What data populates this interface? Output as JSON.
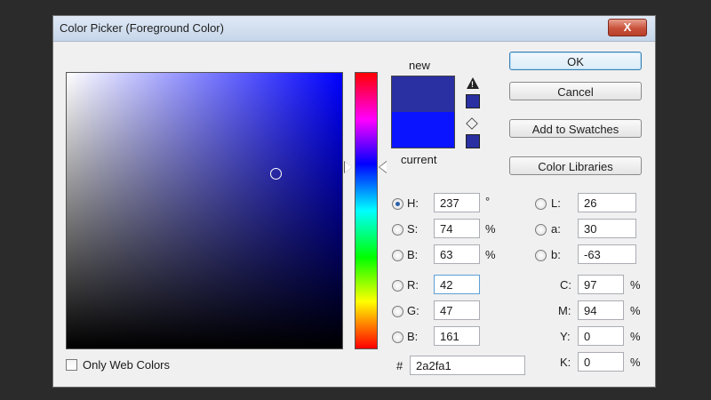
{
  "dialog": {
    "title": "Color Picker (Foreground Color)",
    "close_label": "X"
  },
  "colors": {
    "new_color": "#2a2fa1",
    "current_color": "#0a14ff",
    "field_hue": "#0000ff"
  },
  "preview": {
    "new_label": "new",
    "current_label": "current",
    "warning_icon": "out-of-gamut-warning-icon",
    "cube_icon": "web-safe-cube-icon"
  },
  "buttons": {
    "ok": "OK",
    "cancel": "Cancel",
    "add_to_swatches": "Add to Swatches",
    "color_libraries": "Color Libraries"
  },
  "hsb": [
    {
      "label": "H:",
      "value": "237",
      "unit": "°",
      "checked": true
    },
    {
      "label": "S:",
      "value": "74",
      "unit": "%",
      "checked": false
    },
    {
      "label": "B:",
      "value": "63",
      "unit": "%",
      "checked": false
    }
  ],
  "rgb": [
    {
      "label": "R:",
      "value": "42"
    },
    {
      "label": "G:",
      "value": "47"
    },
    {
      "label": "B:",
      "value": "161"
    }
  ],
  "lab": [
    {
      "label": "L:",
      "value": "26"
    },
    {
      "label": "a:",
      "value": "30"
    },
    {
      "label": "b:",
      "value": "-63"
    }
  ],
  "cmyk": [
    {
      "label": "C:",
      "value": "97",
      "unit": "%"
    },
    {
      "label": "M:",
      "value": "94",
      "unit": "%"
    },
    {
      "label": "Y:",
      "value": "0",
      "unit": "%"
    },
    {
      "label": "K:",
      "value": "0",
      "unit": "%"
    }
  ],
  "hex": {
    "label": "#",
    "value": "2a2fa1"
  },
  "only_web_colors": {
    "label": "Only Web Colors",
    "checked": false
  }
}
